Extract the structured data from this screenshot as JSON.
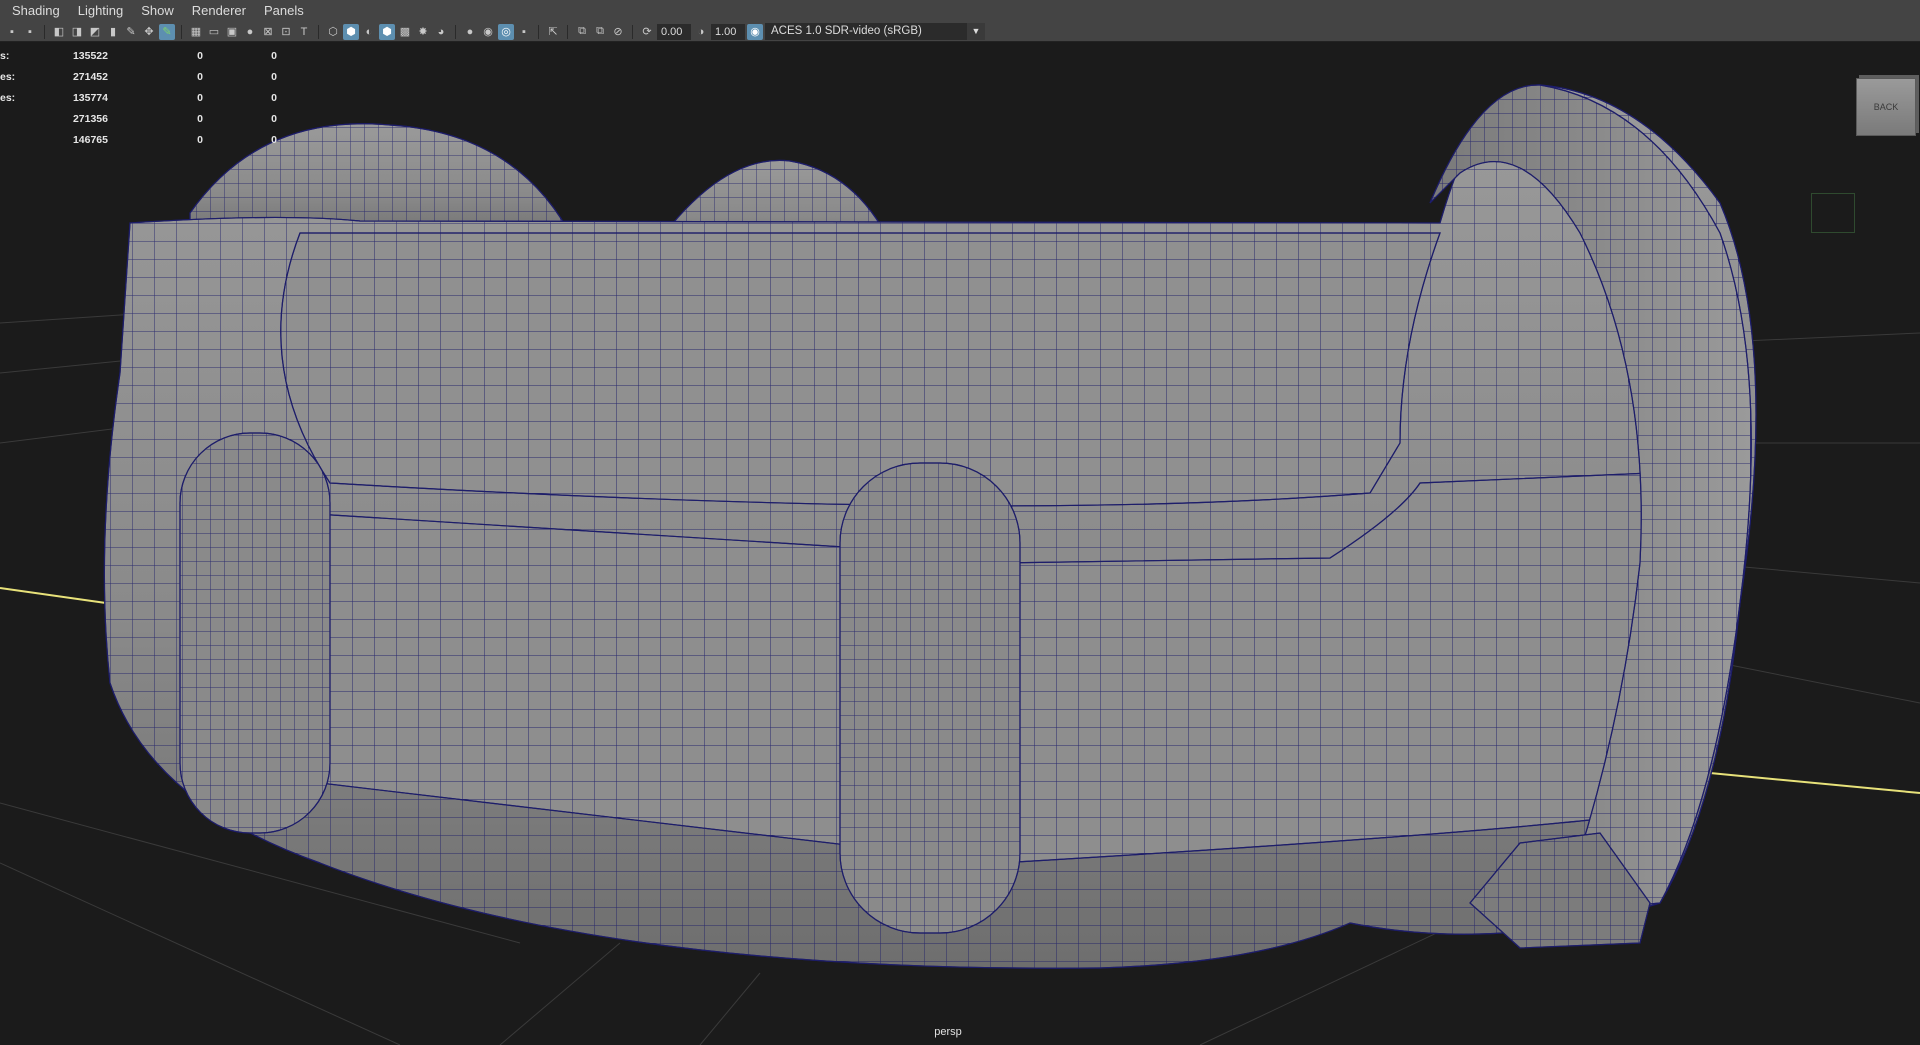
{
  "menu": {
    "items": [
      "Shading",
      "Lighting",
      "Show",
      "Renderer",
      "Panels"
    ]
  },
  "toolbar": {
    "exposure": "0.00",
    "gamma": "1.00",
    "color_transform": "ACES 1.0 SDR-video (sRGB)",
    "icons": [
      "select-camera-icon",
      "lock-camera-icon",
      "camera-attributes-icon",
      "bookmark-icon",
      "image-plane-icon",
      "grease-pencil-icon",
      "2d-pan-zoom-icon",
      "grid-icon",
      "film-gate-icon",
      "resolution-gate-icon",
      "gate-mask-icon",
      "field-chart-icon",
      "safe-action-icon",
      "safe-title-icon",
      "wireframe-icon",
      "smooth-shade-icon",
      "default-material-icon",
      "wireframe-on-shaded-icon",
      "xray-icon",
      "xray-joints-icon",
      "use-all-lights-icon",
      "shadows-icon",
      "screen-space-ao-icon",
      "motion-blur-icon",
      "multisample-aa-icon",
      "depth-of-field-icon",
      "isolate-select-icon",
      "xray-active-icon",
      "isolate-icon",
      "exposure-icon",
      "gamma-icon",
      "color-management-icon"
    ]
  },
  "hud": {
    "rows": [
      {
        "label": "s:",
        "v1": "135522",
        "v2": "0",
        "v3": "0"
      },
      {
        "label": "es:",
        "v1": "271452",
        "v2": "0",
        "v3": "0"
      },
      {
        "label": "es:",
        "v1": "135774",
        "v2": "0",
        "v3": "0"
      },
      {
        "label": "",
        "v1": "271356",
        "v2": "0",
        "v3": "0"
      },
      {
        "label": "",
        "v1": "146765",
        "v2": "0",
        "v3": "0"
      }
    ]
  },
  "viewcube": {
    "label": "BACK"
  },
  "camera": {
    "label": "persp"
  },
  "colors": {
    "background": "#1b1b1b",
    "grid": "#3a3a3a",
    "axis": "#e8e27a",
    "mesh_fill": "#8a8a8a",
    "wire": "#1d1d6a"
  }
}
